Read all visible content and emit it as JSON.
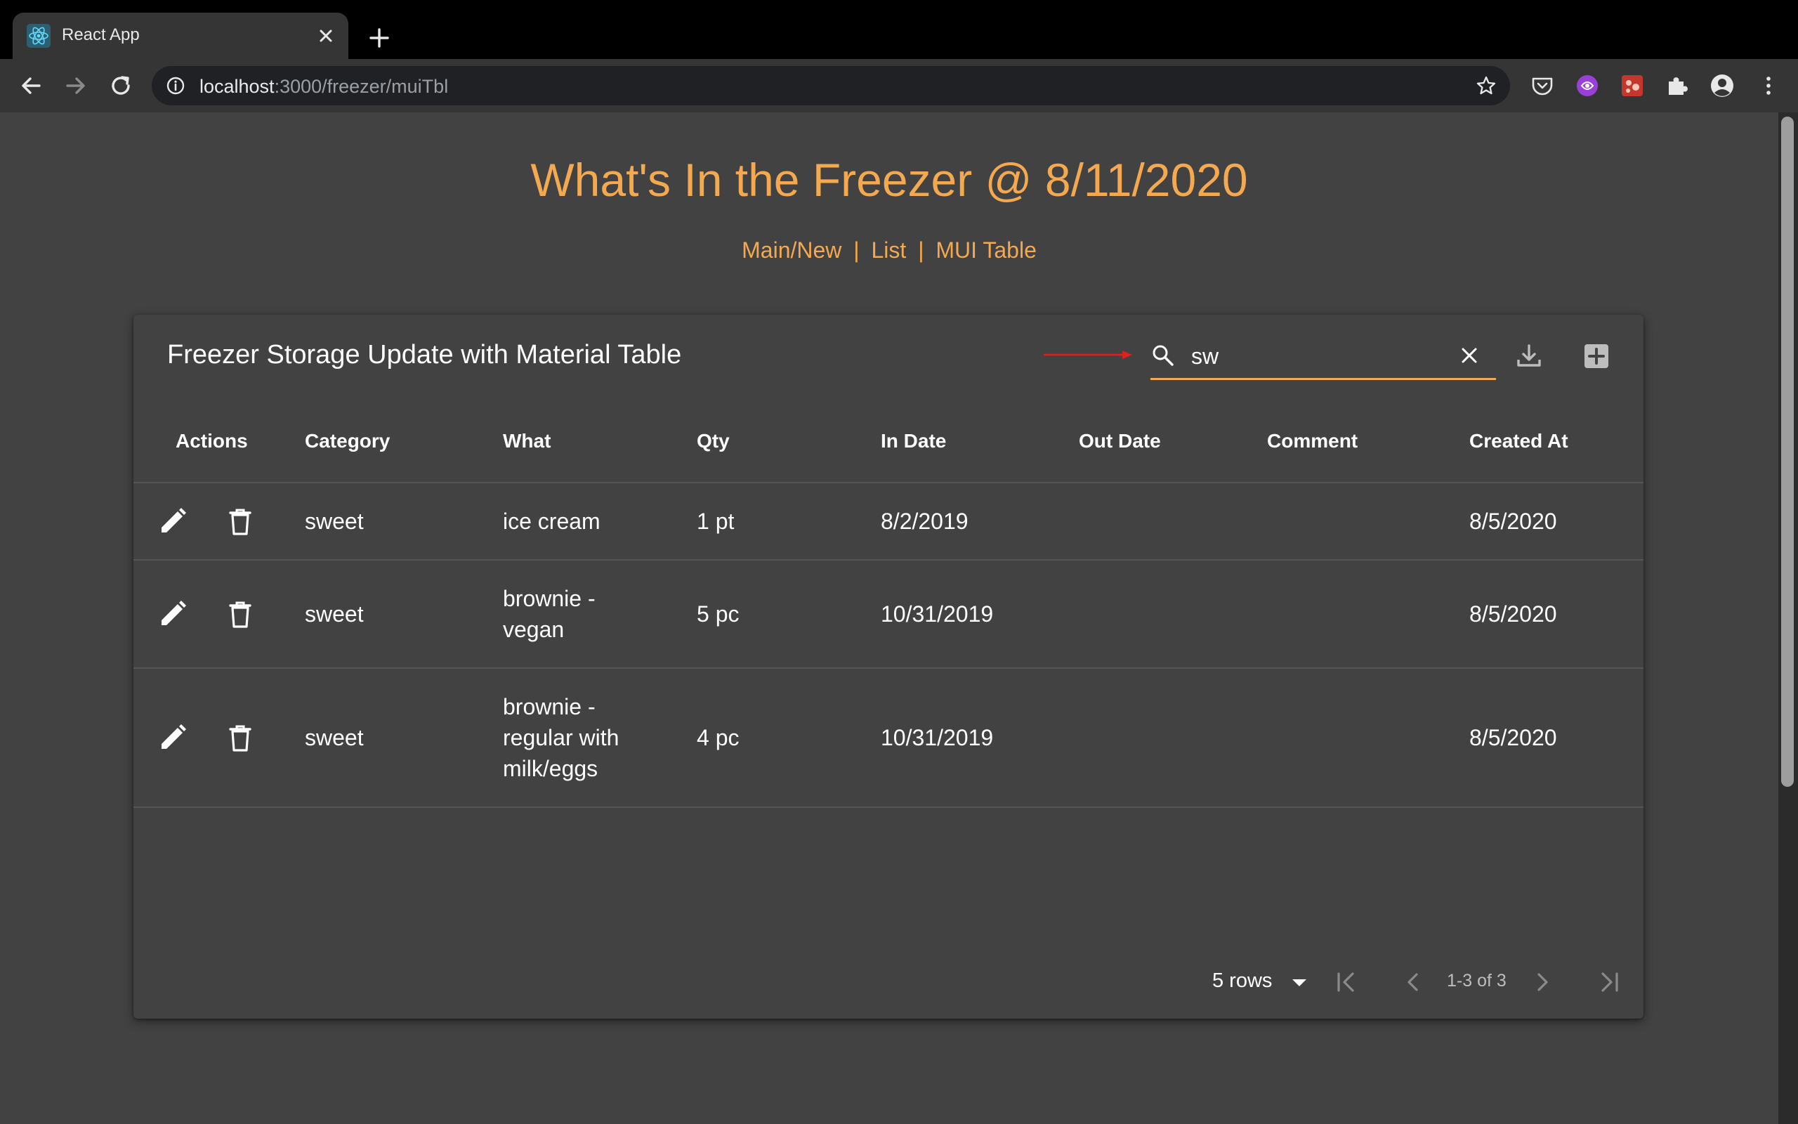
{
  "browser": {
    "tab_title": "React App",
    "url_host": "localhost",
    "url_path": ":3000/freezer/muiTbl"
  },
  "page": {
    "title": "What's In the Freezer @ 8/11/2020",
    "nav": {
      "main": "Main/New",
      "list": "List",
      "mui": "MUI Table",
      "separator": "|"
    }
  },
  "table": {
    "title": "Freezer Storage Update with Material Table",
    "search_value": "sw",
    "columns": [
      "Actions",
      "Category",
      "What",
      "Qty",
      "In Date",
      "Out Date",
      "Comment",
      "Created At"
    ],
    "rows": [
      {
        "category": "sweet",
        "what": "ice cream",
        "qty": "1 pt",
        "in_date": "8/2/2019",
        "out_date": "",
        "comment": "",
        "created_at": "8/5/2020"
      },
      {
        "category": "sweet",
        "what": "brownie - vegan",
        "qty": "5 pc",
        "in_date": "10/31/2019",
        "out_date": "",
        "comment": "",
        "created_at": "8/5/2020"
      },
      {
        "category": "sweet",
        "what": "brownie - regular with milk/eggs",
        "qty": "4 pc",
        "in_date": "10/31/2019",
        "out_date": "",
        "comment": "",
        "created_at": "8/5/2020"
      }
    ],
    "pagination": {
      "rows_per_page": "5 rows",
      "range": "1-3 of 3"
    }
  },
  "colors": {
    "accent": "#f4a950",
    "background": "#424242",
    "annotation_arrow": "#e02020"
  }
}
